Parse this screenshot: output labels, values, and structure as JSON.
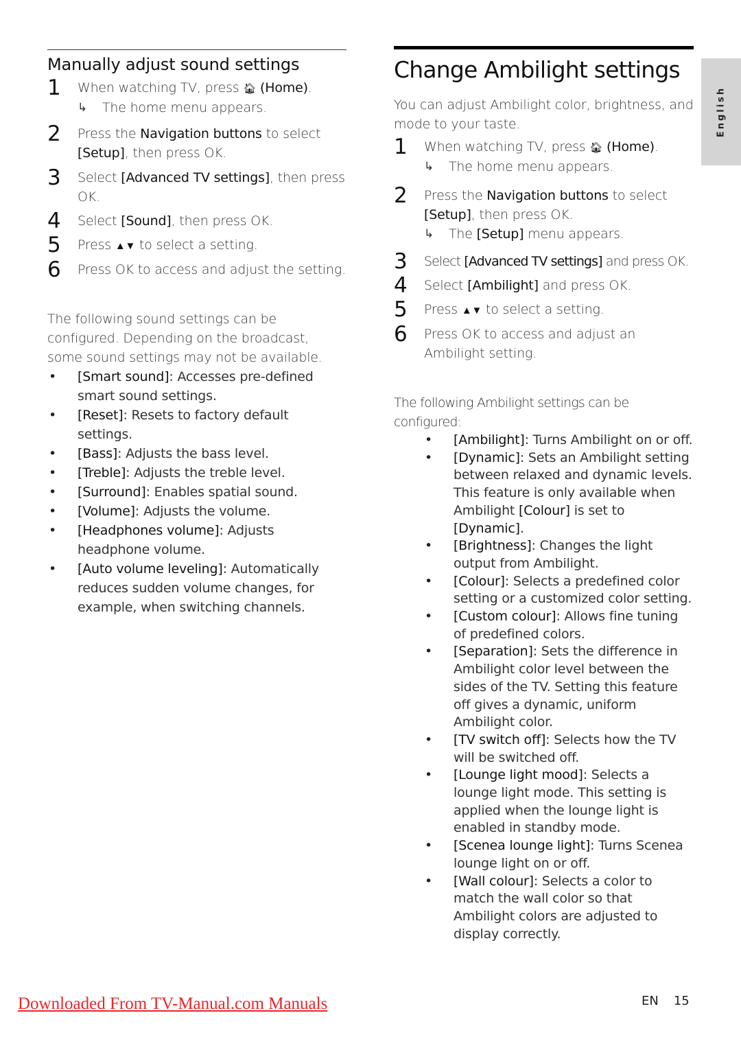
{
  "side_tab": {
    "label": "English"
  },
  "left": {
    "heading": "Manually adjust sound settings",
    "steps": [
      {
        "num": "1",
        "parts": [
          "When watching TV, press ",
          "(Home)",
          "."
        ],
        "home_icon": "home-icon",
        "result": "The home menu appears."
      },
      {
        "num": "2",
        "pre": "Press the ",
        "em": "Navigation buttons",
        "post": " to select",
        "line2_em": "[Setup]",
        "line2_post": ", then press OK."
      },
      {
        "num": "3",
        "pre": "Select ",
        "em": "[Advanced TV settings]",
        "post": ", then press OK."
      },
      {
        "num": "4",
        "pre": "Select ",
        "em": "[Sound]",
        "post": ", then press OK."
      },
      {
        "num": "5",
        "pre": "Press ",
        "icon": "up-down-arrows-icon",
        "post": " to select a setting."
      },
      {
        "num": "6",
        "text": "Press OK to access and adjust the setting."
      }
    ],
    "intro": "The following sound settings can be configured. Depending on the broadcast, some sound settings may not be available.",
    "bullets": [
      {
        "term": "[Smart sound]",
        "desc": ": Accesses pre-defined smart sound settings."
      },
      {
        "term": "[Reset]",
        "desc": ": Resets to factory default settings."
      },
      {
        "term": "[Bass]",
        "desc": ": Adjusts the bass level."
      },
      {
        "term": "[Treble]",
        "desc": ": Adjusts the treble level."
      },
      {
        "term": "[Surround]",
        "desc": ": Enables spatial sound."
      },
      {
        "term": "[Volume]",
        "desc": ": Adjusts the volume."
      },
      {
        "term": "[Headphones volume]",
        "desc": ": Adjusts headphone volume."
      },
      {
        "term": "[Auto volume leveling]",
        "desc": ": Automatically reduces sudden volume changes, for example, when switching channels."
      }
    ]
  },
  "right": {
    "heading": "Change Ambilight settings",
    "intro": "You can adjust Ambilight color, brightness, and mode to your taste.",
    "steps": [
      {
        "num": "1",
        "pre": "When watching TV, press ",
        "em": "(Home)",
        "post": ".",
        "result": "The home menu appears."
      },
      {
        "num": "2",
        "pre": "Press the ",
        "em": "Navigation buttons",
        "post": " to select",
        "line2_em": "[Setup]",
        "line2_post": ", then press OK.",
        "result_pre": "The ",
        "result_em": "[Setup]",
        "result_post": " menu appears."
      },
      {
        "num": "3",
        "pre": "Select ",
        "em": "[Advanced TV settings]",
        "post": " and press OK."
      },
      {
        "num": "4",
        "pre": "Select ",
        "em": "[Ambilight]",
        "post": " and press OK."
      },
      {
        "num": "5",
        "pre": "Press ",
        "post": " to select a setting."
      },
      {
        "num": "6",
        "text": "Press OK to access and adjust an Ambilight setting."
      }
    ],
    "list_intro": "The following Ambilight settings can be configured:",
    "bullets": [
      {
        "term": "[Ambilight]",
        "desc": ": Turns Ambilight on or off."
      },
      {
        "term": "[Dynamic]",
        "desc": ": Sets an Ambilight setting between relaxed and dynamic levels. This feature is only available when Ambilight ",
        "term2": "[Colour]",
        "desc2": " is set to ",
        "term3": "[Dynamic]",
        "desc3": "."
      },
      {
        "term": "[Brightness]",
        "desc": ": Changes the light output from Ambilight."
      },
      {
        "term": "[Colour]",
        "desc": ": Selects a predefined color setting or a customized color setting."
      },
      {
        "term": "[Custom colour]",
        "desc": ": Allows fine tuning of predefined colors."
      },
      {
        "term": "[Separation]",
        "desc": ": Sets the difference in Ambilight color level between the sides of the TV. Setting this feature off gives a dynamic, uniform Ambilight color."
      },
      {
        "term": "[TV switch off]",
        "desc": ": Selects how the TV will be switched off."
      },
      {
        "term": "[Lounge light mood]",
        "desc": ": Selects a lounge light mode. This setting is applied when the lounge light is enabled in standby mode."
      },
      {
        "term": "[Scenea lounge light]",
        "desc": ": Turns Scenea lounge light on or off."
      },
      {
        "term": "[Wall colour]",
        "desc": ": Selects a color to match the wall color so that Ambilight colors are adjusted to display correctly."
      }
    ]
  },
  "footer": {
    "link": "Downloaded From TV-Manual.com Manuals",
    "lang": "EN",
    "page": "15",
    "link_color": "#e8262b"
  }
}
